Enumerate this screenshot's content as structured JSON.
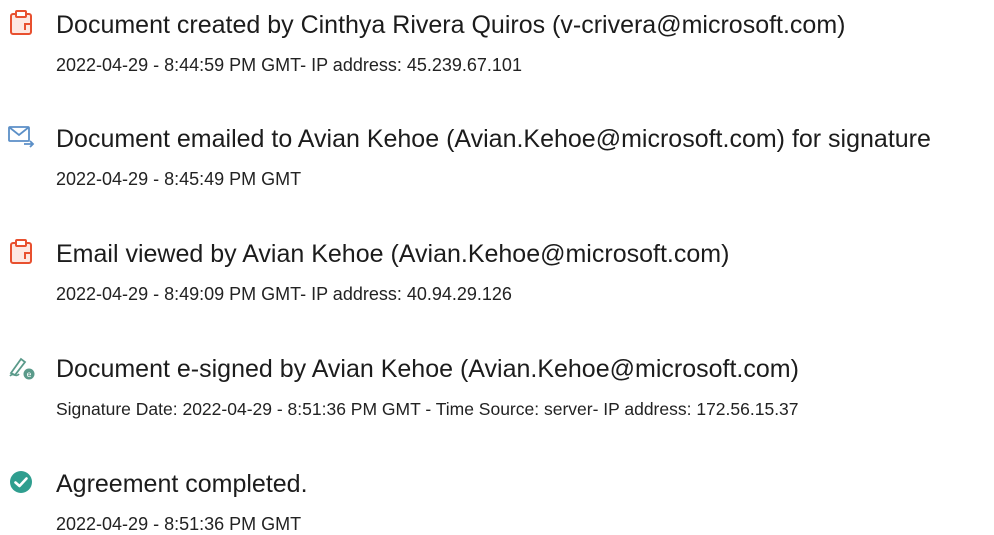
{
  "events": [
    {
      "icon": "document-created-icon",
      "title": "Document created by Cinthya Rivera Quiros (v-crivera@microsoft.com)",
      "detail": "2022-04-29 - 8:44:59 PM GMT- IP address: 45.239.67.101"
    },
    {
      "icon": "email-sent-icon",
      "title": "Document emailed to Avian Kehoe (Avian.Kehoe@microsoft.com) for signature",
      "detail": "2022-04-29 - 8:45:49 PM GMT"
    },
    {
      "icon": "email-viewed-icon",
      "title": "Email viewed by Avian Kehoe (Avian.Kehoe@microsoft.com)",
      "detail": "2022-04-29 - 8:49:09 PM GMT- IP address: 40.94.29.126"
    },
    {
      "icon": "e-signature-icon",
      "title": "Document e-signed by Avian Kehoe (Avian.Kehoe@microsoft.com)",
      "detail": "Signature Date: 2022-04-29 - 8:51:36 PM GMT - Time Source: server- IP address: 172.56.15.37"
    },
    {
      "icon": "check-circle-icon",
      "title": "Agreement completed.",
      "detail": "2022-04-29 - 8:51:36 PM GMT"
    }
  ],
  "colors": {
    "document_icon": "#e8502f",
    "email_icon": "#5b8fc7",
    "signature_icon": "#5a9a8a",
    "check_icon": "#2f9e8f"
  }
}
